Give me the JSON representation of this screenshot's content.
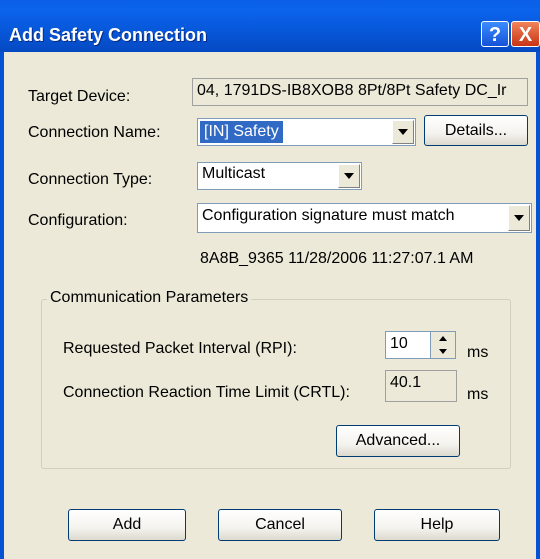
{
  "window": {
    "title": "Add Safety Connection",
    "help_glyph": "?",
    "close_glyph": "X"
  },
  "form": {
    "target_device_label": "Target Device:",
    "target_device_value": "04, 1791DS-IB8XOB8 8Pt/8Pt Safety DC_Ir",
    "connection_name_label": "Connection Name:",
    "connection_name_value": "[IN] Safety",
    "details_button": "Details...",
    "connection_type_label": "Connection Type:",
    "connection_type_value": "Multicast",
    "configuration_label": "Configuration:",
    "configuration_value": "Configuration signature must match",
    "signature_text": "8A8B_9365 11/28/2006 11:27:07.1 AM"
  },
  "comm_params": {
    "group_title": "Communication Parameters",
    "rpi_label": "Requested Packet Interval (RPI):",
    "rpi_value": "10",
    "rpi_unit": "ms",
    "crtl_label": "Connection Reaction Time Limit (CRTL):",
    "crtl_value": "40.1",
    "crtl_unit": "ms",
    "advanced_button": "Advanced..."
  },
  "footer": {
    "add_button": "Add",
    "cancel_button": "Cancel",
    "help_button": "Help"
  },
  "colors": {
    "titlebar": "#0757D9",
    "dialog_bg": "#ECE9D8",
    "selection": "#316AC5"
  }
}
